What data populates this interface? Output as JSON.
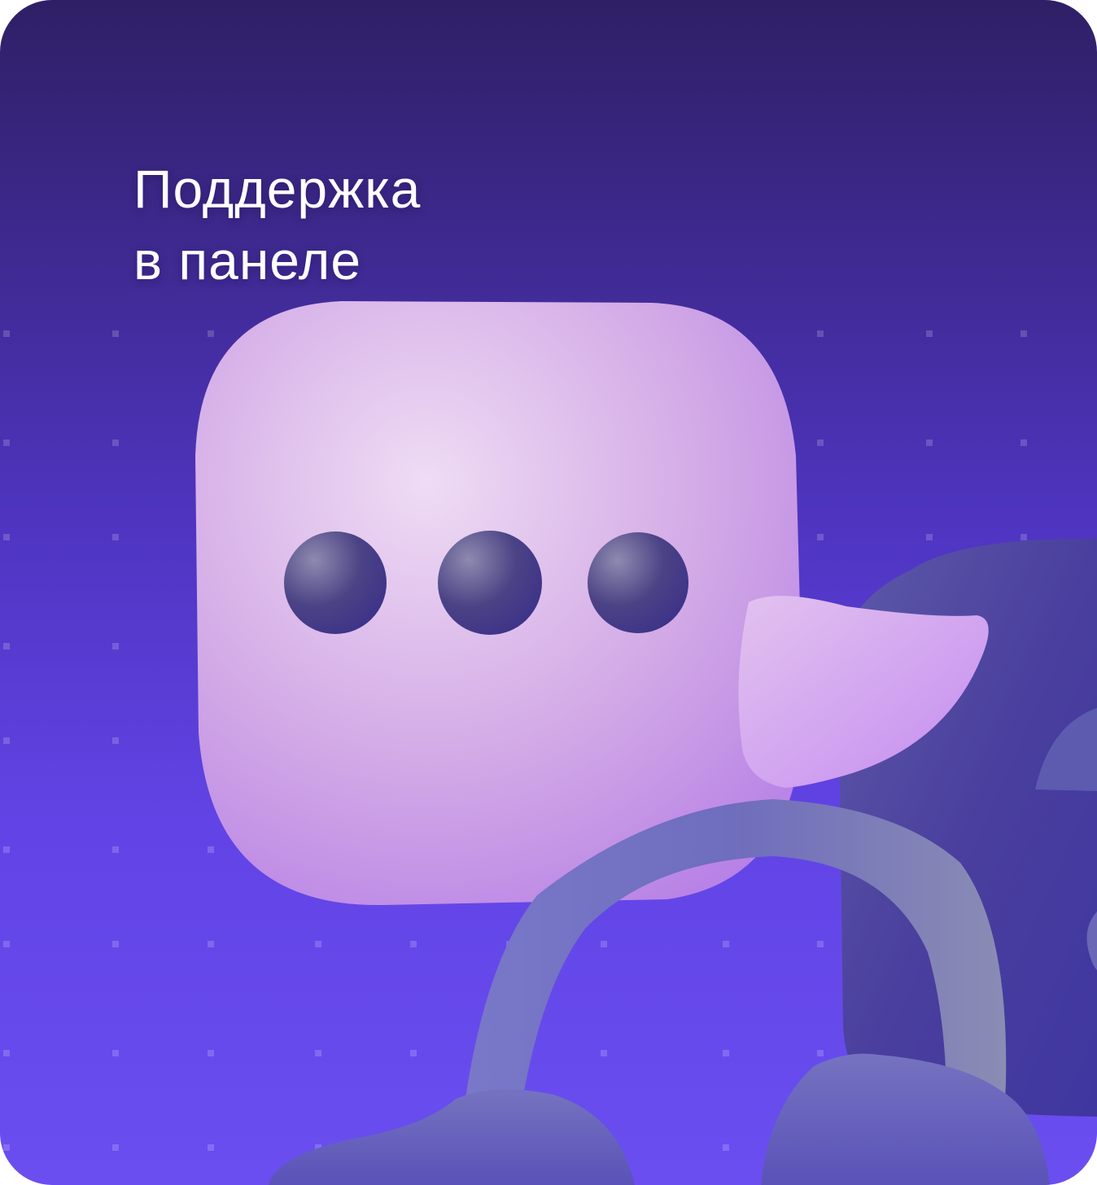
{
  "promo_card": {
    "title_line_1": "Поддержка",
    "title_line_2": "в панеле",
    "background_top": "#2f1f66",
    "background_bottom": "#6a4ef0",
    "illustration": {
      "chat_bubble_icon": "chat-bubble-typing-icon",
      "headset_icon": "headset-icon",
      "phone_icon": "phone-icon"
    }
  }
}
